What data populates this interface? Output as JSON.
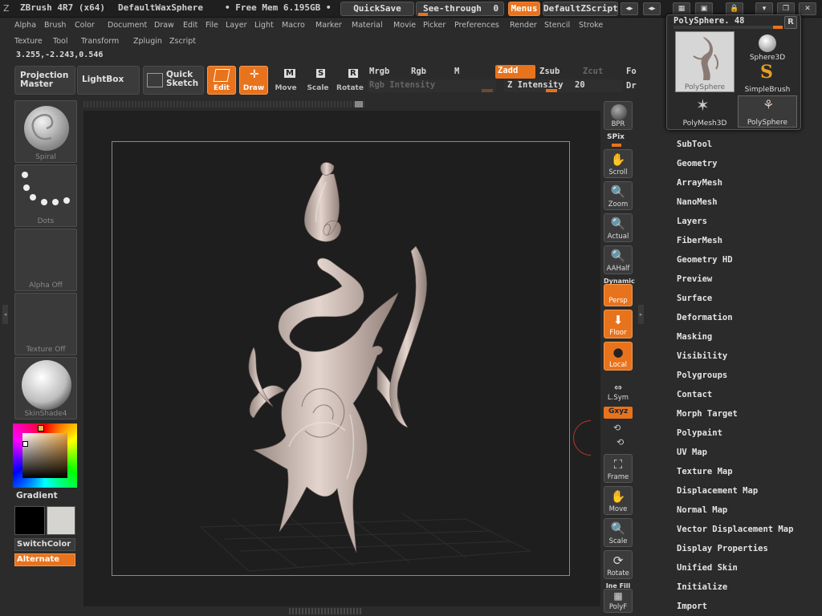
{
  "titlebar": {
    "app": "ZBrush 4R7 (x64)",
    "document": "DefaultWaxSphere",
    "memory": "• Free Mem 6.195GB •",
    "quicksave": "QuickSave",
    "seethrough_label": "See-through",
    "seethrough_value": "0",
    "menus": "Menus",
    "zscript": "DefaultZScript"
  },
  "menu_row1": [
    "Alpha",
    "Brush",
    "Color",
    "Document",
    "Draw",
    "Edit",
    "File",
    "Layer",
    "Light",
    "Macro",
    "Marker",
    "Material",
    "Movie",
    "Picker",
    "Preferences",
    "Render",
    "Stencil",
    "Stroke"
  ],
  "menu_row2": [
    "Texture",
    "Tool",
    "Transform",
    "Zplugin",
    "Zscript"
  ],
  "coords": "3.255,-2.243,0.546",
  "toolbar": {
    "projection_master": "Projection Master",
    "lightbox": "LightBox",
    "quick_sketch": "Quick Sketch",
    "edit": "Edit",
    "draw": "Draw",
    "move": "Move",
    "scale": "Scale",
    "rotate": "Rotate"
  },
  "sliders": {
    "mrgb": "Mrgb",
    "rgb": "Rgb",
    "m": "M",
    "rgb_intensity": "Rgb Intensity",
    "zadd": "Zadd",
    "zsub": "Zsub",
    "zcut": "Zcut",
    "z_intensity_label": "Z Intensity",
    "z_intensity_value": "20",
    "focal": "Fo",
    "draw_size": "Dr"
  },
  "left_tiles": {
    "brush": "Spiral",
    "stroke": "Dots",
    "alpha": "Alpha Off",
    "texture": "Texture Off",
    "material": "SkinShade4",
    "gradient": "Gradient",
    "switch_color": "SwitchColor",
    "alternate": "Alternate"
  },
  "shelf": {
    "bpr": "BPR",
    "spix_label": "SPix",
    "scroll": "Scroll",
    "zoom": "Zoom",
    "actual": "Actual",
    "aahalf": "AAHalf",
    "dynamic": "Dynamic",
    "persp": "Persp",
    "floor": "Floor",
    "local": "Local",
    "lsym": "L.Sym",
    "xyz": "Gxyz",
    "frame": "Frame",
    "move": "Move",
    "scale": "Scale",
    "rotate": "Rotate",
    "line_fill": "Ine Fill",
    "polyf": "PolyF"
  },
  "tool_popup": {
    "header": "PolySphere. 48",
    "r_button": "R",
    "tiles": [
      "PolySphere",
      "Sphere3D",
      "SimpleBrush",
      "PolyMesh3D",
      "PolySphere"
    ]
  },
  "subpalettes": [
    "SubTool",
    "Geometry",
    "ArrayMesh",
    "NanoMesh",
    "Layers",
    "FiberMesh",
    "Geometry HD",
    "Preview",
    "Surface",
    "Deformation",
    "Masking",
    "Visibility",
    "Polygroups",
    "Contact",
    "Morph Target",
    "Polypaint",
    "UV Map",
    "Texture Map",
    "Displacement Map",
    "Normal Map",
    "Vector Displacement Map",
    "Display Properties",
    "Unified Skin",
    "Initialize",
    "Import"
  ],
  "colors": {
    "accent": "#e8731d",
    "bg": "#2b2b2b",
    "canvas": "#202020",
    "model": "#d9c9c2"
  }
}
